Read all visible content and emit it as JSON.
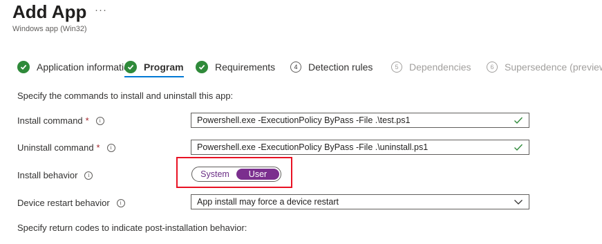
{
  "header": {
    "title": "Add App",
    "more": "···",
    "subtitle": "Windows app (Win32)"
  },
  "tabs": [
    {
      "label": "Application information",
      "status": "complete"
    },
    {
      "label": "Program",
      "status": "complete",
      "selected": true
    },
    {
      "label": "Requirements",
      "status": "complete"
    },
    {
      "label": "Detection rules",
      "step": "4"
    },
    {
      "label": "Dependencies",
      "step": "5",
      "disabled": true
    },
    {
      "label": "Supersedence (preview)",
      "step": "6",
      "disabled": true
    }
  ],
  "program": {
    "intro": "Specify the commands to install and uninstall this app:",
    "install_command": {
      "label": "Install command",
      "required": "*",
      "info": "i",
      "value": "Powershell.exe -ExecutionPolicy ByPass -File .\\test.ps1"
    },
    "uninstall_command": {
      "label": "Uninstall command",
      "required": "*",
      "info": "i",
      "value": "Powershell.exe -ExecutionPolicy ByPass -File .\\uninstall.ps1"
    },
    "install_behavior": {
      "label": "Install behavior",
      "info": "i",
      "options": [
        "System",
        "User"
      ],
      "selected": "User"
    },
    "restart_behavior": {
      "label": "Device restart behavior",
      "info": "i",
      "value": "App install may force a device restart"
    },
    "return_codes_intro": "Specify return codes to indicate post-installation behavior:"
  },
  "colors": {
    "accent": "#0078d4",
    "success": "#2f8a3a",
    "toggle_selected": "#7b2f8e",
    "highlight": "#e81123"
  }
}
